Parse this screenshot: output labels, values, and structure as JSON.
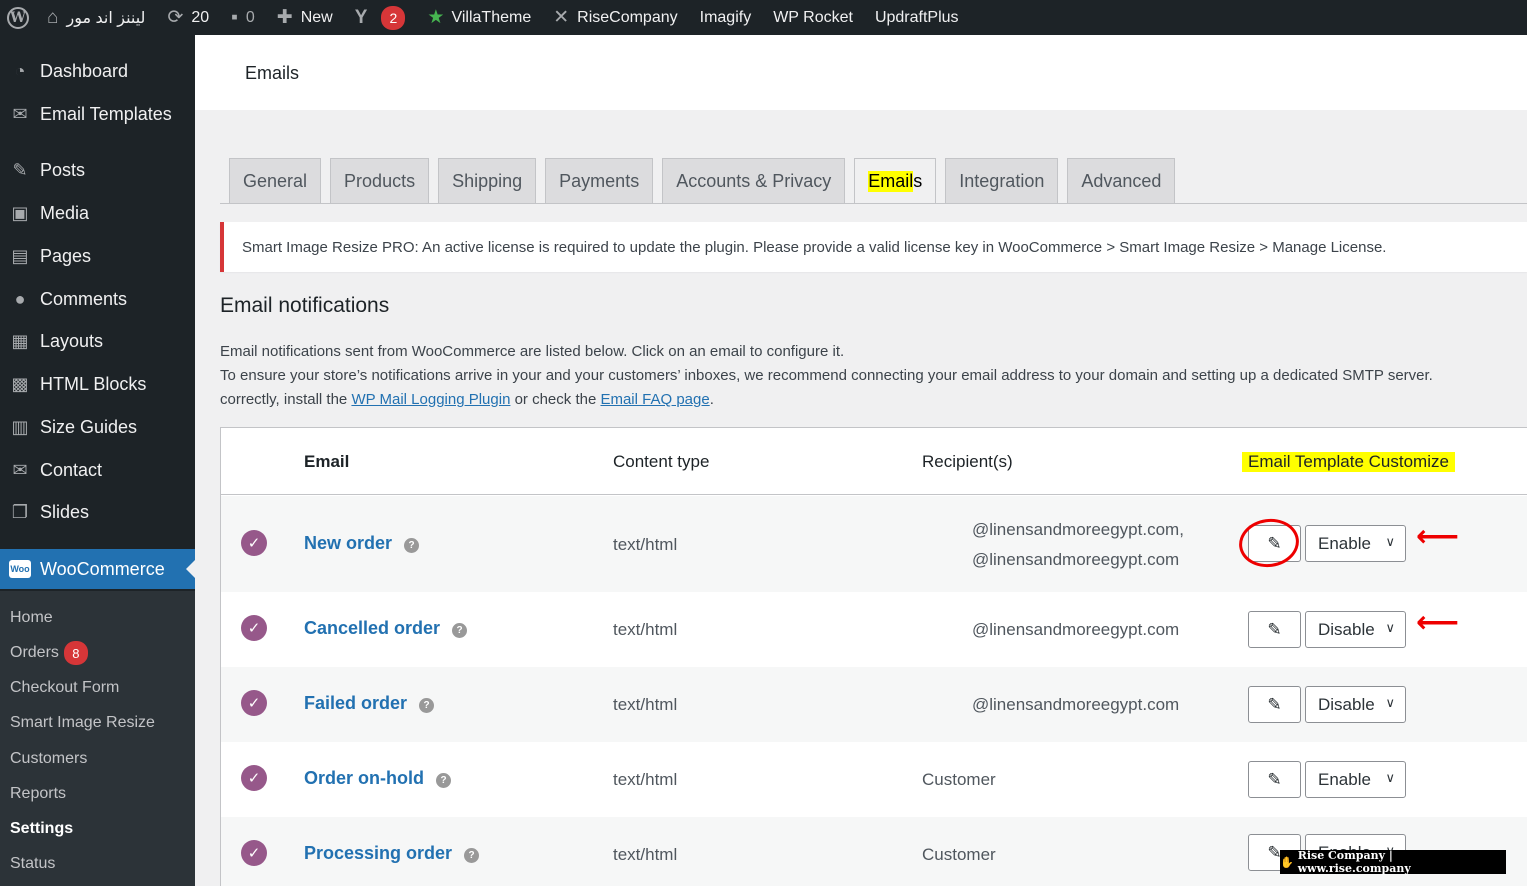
{
  "admin_bar": {
    "site_name": "ليننز اند مور",
    "updates_count": "20",
    "comments_count": "0",
    "new_label": "New",
    "yoast_badge": "2",
    "items": [
      "VillaTheme",
      "RiseCompany",
      "Imagify",
      "WP Rocket",
      "UpdraftPlus"
    ]
  },
  "sidebar": {
    "menu": [
      {
        "label": "Dashboard",
        "icon": "dashboard-icon"
      },
      {
        "label": "Email Templates",
        "icon": "mail-icon"
      },
      {
        "label": "Posts",
        "icon": "pin-icon"
      },
      {
        "label": "Media",
        "icon": "media-icon"
      },
      {
        "label": "Pages",
        "icon": "pages-icon"
      },
      {
        "label": "Comments",
        "icon": "comment-icon"
      },
      {
        "label": "Layouts",
        "icon": "layouts-icon"
      },
      {
        "label": "HTML Blocks",
        "icon": "blocks-icon"
      },
      {
        "label": "Size Guides",
        "icon": "table-icon"
      },
      {
        "label": "Contact",
        "icon": "mail-icon"
      },
      {
        "label": "Slides",
        "icon": "slides-icon"
      },
      {
        "label": "WooCommerce",
        "icon": "woo-icon",
        "icon_text": "Woo"
      }
    ],
    "submenu": [
      {
        "label": "Home"
      },
      {
        "label": "Orders",
        "badge": "8"
      },
      {
        "label": "Checkout Form"
      },
      {
        "label": "Smart Image Resize"
      },
      {
        "label": "Customers"
      },
      {
        "label": "Reports"
      },
      {
        "label": "Settings"
      },
      {
        "label": "Status"
      }
    ]
  },
  "header": {
    "title": "Emails"
  },
  "tabs": [
    {
      "label": "General"
    },
    {
      "label": "Products"
    },
    {
      "label": "Shipping"
    },
    {
      "label": "Payments"
    },
    {
      "label": "Accounts & Privacy"
    },
    {
      "label_hl": "Email",
      "label_rest": "s"
    },
    {
      "label": "Integration"
    },
    {
      "label": "Advanced"
    }
  ],
  "notice": "Smart Image Resize PRO: An active license is required to update the plugin. Please provide a valid license key in WooCommerce > Smart Image Resize > Manage License.",
  "section": {
    "title": "Email notifications",
    "line1": "Email notifications sent from WooCommerce are listed below. Click on an email to configure it.",
    "line2": "To ensure your store’s notifications arrive in your and your customers’ inboxes, we recommend connecting your email address to your domain and setting up a dedicated SMTP server.",
    "line3_pre": "correctly, install the ",
    "link1": "WP Mail Logging Plugin",
    "line3_mid": " or check the ",
    "link2": "Email FAQ page",
    "line3_post": "."
  },
  "table": {
    "headers": {
      "email": "Email",
      "content_type": "Content type",
      "recipients": "Recipient(s)",
      "customize": "Email Template Customize"
    },
    "rows": [
      {
        "name": "New order",
        "content_type": "text/html",
        "recipients": [
          "@linensandmoreegypt.com,",
          "@linensandmoreegypt.com"
        ],
        "status": "Enable"
      },
      {
        "name": "Cancelled order",
        "content_type": "text/html",
        "recipients": [
          "@linensandmoreegypt.com"
        ],
        "status": "Disable"
      },
      {
        "name": "Failed order",
        "content_type": "text/html",
        "recipients": [
          "@linensandmoreegypt.com"
        ],
        "status": "Disable"
      },
      {
        "name": "Order on-hold",
        "content_type": "text/html",
        "recipients": [
          "Customer"
        ],
        "status": "Enable"
      },
      {
        "name": "Processing order",
        "content_type": "text/html",
        "recipients": [
          "Customer"
        ],
        "status": "Enable"
      }
    ]
  },
  "watermark": "Rise Company | www.rise.company",
  "colors": {
    "admin_bar": "#1d2327",
    "accent": "#2271b1",
    "woo_purple": "#96588a",
    "highlight": "#ffff00",
    "annotation_red": "#ee0000"
  }
}
